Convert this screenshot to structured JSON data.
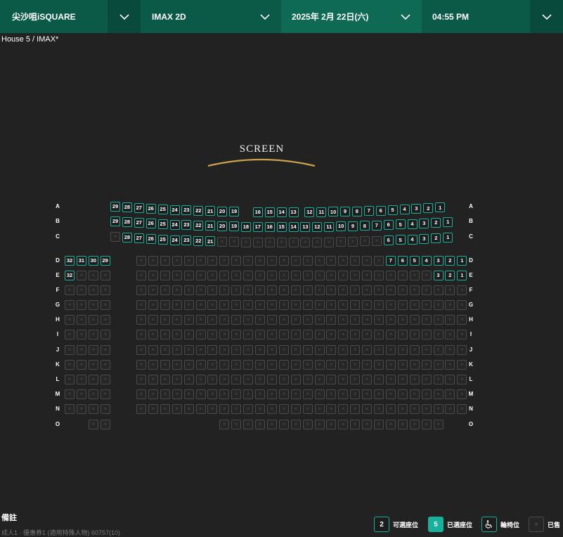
{
  "header": {
    "cinema": "尖沙咀iSQUARE",
    "format": "IMAX 2D",
    "date": "2025年 2月 22日(六)",
    "time": "04:55 PM"
  },
  "house_label": "House 5 / IMAX*",
  "screen_label": "SCREEN",
  "colors": {
    "available": "#17b09a",
    "selected": "#17b09a",
    "header": "#0b5a48",
    "background": "#222222"
  },
  "rows": [
    "A",
    "B",
    "C",
    "D",
    "E",
    "F",
    "G",
    "H",
    "I",
    "J",
    "K",
    "L",
    "M",
    "N",
    "O"
  ],
  "seat_plan": {
    "A": {
      "available": [
        "29",
        "28",
        "27",
        "26",
        "25",
        "24",
        "23",
        "22",
        "21",
        "20",
        "19",
        "16",
        "15",
        "14",
        "13",
        "12",
        "11",
        "10",
        "9",
        "8",
        "7",
        "6",
        "5",
        "4",
        "3",
        "2",
        "1"
      ],
      "sold": 0
    },
    "B": {
      "available": [
        "29",
        "28",
        "27",
        "26",
        "25",
        "24",
        "23",
        "22",
        "21",
        "20",
        "19",
        "18",
        "17",
        "16",
        "15",
        "14",
        "13",
        "12",
        "11",
        "10",
        "9",
        "8",
        "7",
        "6",
        "5",
        "4",
        "3",
        "2",
        "1"
      ],
      "sold": 1
    },
    "C": {
      "available": [
        "28",
        "27",
        "26",
        "25",
        "24",
        "23",
        "22",
        "21",
        "6",
        "5",
        "4",
        "3",
        "2",
        "1"
      ],
      "sold": 17
    },
    "D": {
      "available": [
        "32",
        "31",
        "30",
        "29",
        "7",
        "6",
        "5",
        "4",
        "3",
        "2",
        "1"
      ],
      "sold": 21
    },
    "E": {
      "available": [
        "32",
        "3",
        "2",
        "1"
      ],
      "sold": 28
    },
    "F": {
      "available": [],
      "sold": 32
    },
    "G": {
      "available": [],
      "sold": 32
    },
    "H": {
      "available": [],
      "sold": 32
    },
    "I": {
      "available": [],
      "sold": 32
    },
    "J": {
      "available": [],
      "sold": 32
    },
    "K": {
      "available": [],
      "sold": 32
    },
    "L": {
      "available": [],
      "sold": 32
    },
    "M": {
      "available": [],
      "sold": 32
    },
    "N": {
      "available": [],
      "sold": 32
    },
    "O": {
      "available": [],
      "sold": 21
    }
  },
  "notes_title": "備註",
  "notes_text": "成人1 · 優惠券1 (適用特殊人物) 60757(10)",
  "legend": [
    {
      "sample": "2",
      "label": "可選座位"
    },
    {
      "sample": "5",
      "label": "已選座位"
    },
    {
      "icon": "wheelchair-icon",
      "label": "輪椅位"
    },
    {
      "icon": "sold-x-icon",
      "label": "已售"
    }
  ]
}
